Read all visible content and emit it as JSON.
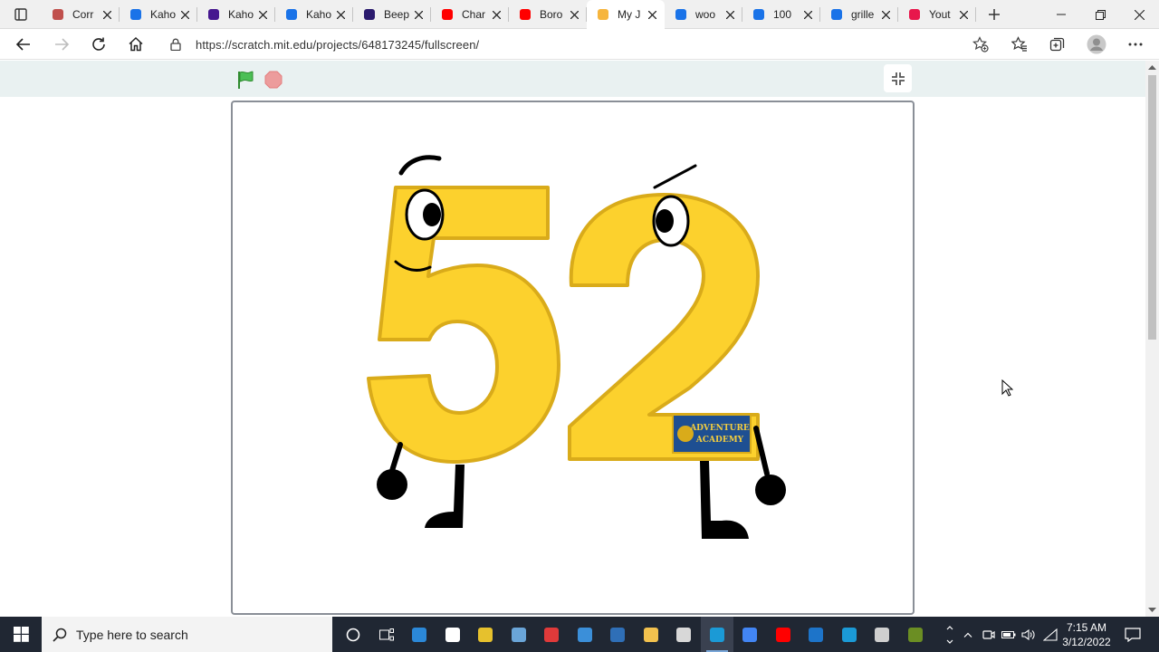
{
  "browser": {
    "tabs": [
      {
        "title": "Corr",
        "favicon": "document-red-icon",
        "color": "#c0504d"
      },
      {
        "title": "Kaho",
        "favicon": "bing-icon",
        "color": "#1a73e8"
      },
      {
        "title": "Kaho",
        "favicon": "kahoot-icon",
        "color": "#46178f"
      },
      {
        "title": "Kaho",
        "favicon": "bing-icon",
        "color": "#1a73e8"
      },
      {
        "title": "Beep",
        "favicon": "circle-app-icon",
        "color": "#2b1b6e"
      },
      {
        "title": "Char",
        "favicon": "youtube-icon",
        "color": "#ff0000"
      },
      {
        "title": "Boro",
        "favicon": "youtube-icon",
        "color": "#ff0000"
      },
      {
        "title": "My J",
        "favicon": "scratch-icon",
        "color": "#f6b53d",
        "active": true
      },
      {
        "title": "woo",
        "favicon": "bing-icon",
        "color": "#1a73e8"
      },
      {
        "title": "100",
        "favicon": "bing-icon",
        "color": "#1a73e8"
      },
      {
        "title": "grille",
        "favicon": "bing-icon",
        "color": "#1a73e8"
      },
      {
        "title": "Yout",
        "favicon": "download-icon",
        "color": "#e8174c"
      }
    ],
    "url": "https://scratch.mit.edu/projects/648173245/fullscreen/"
  },
  "player": {
    "stage_colors": {
      "digit_fill": "#fcd12d",
      "digit_outline": "#d9ab1a",
      "bar_bg": "#e9f1f1"
    },
    "badge_text_line1": "ADVENTURE",
    "badge_text_line2": "ACADEMY",
    "scene_text": "52"
  },
  "taskbar": {
    "search_placeholder": "Type here to search",
    "time": "7:15 AM",
    "date": "3/12/2022",
    "pinned": [
      "cortana-icon",
      "task-view-icon",
      "store-icon",
      "notepad-icon",
      "star-app-icon",
      "paint-icon",
      "record-icon",
      "mail-icon",
      "photos-icon",
      "file-explorer-icon",
      "cloud-app-icon",
      "edge-icon",
      "chrome-icon",
      "youtube-icon",
      "video-icon",
      "edge-icon",
      "paint3d-icon",
      "app-icon"
    ]
  }
}
